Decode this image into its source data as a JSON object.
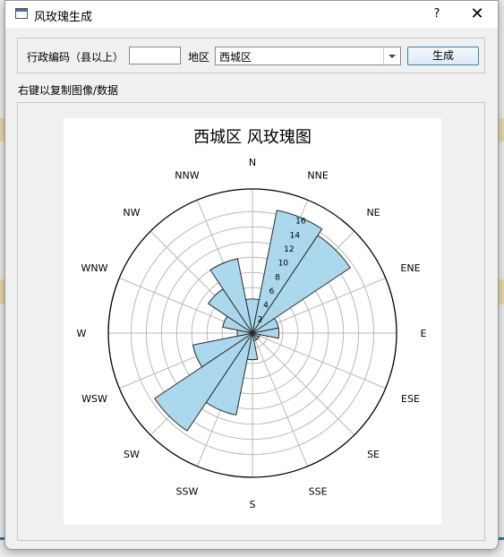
{
  "window": {
    "title": "风玫瑰生成",
    "help_label": "?",
    "close_label": "✕"
  },
  "form": {
    "code_label": "行政编码（县以上）",
    "code_value": "",
    "region_label": "地区",
    "region_value": "西城区",
    "generate_label": "生成"
  },
  "hint": "右键以复制图像/数据",
  "icons": {
    "app": "window-app-icon",
    "dropdown": "chevron-down-icon"
  },
  "colors": {
    "petal_fill": "#a7d6ec",
    "petal_stroke": "#2b2b2b",
    "grid": "#b9b9b9"
  },
  "chart_data": {
    "type": "polar-bar",
    "title": "西城区 风玫瑰图",
    "directions": [
      "N",
      "NNE",
      "NE",
      "ENE",
      "E",
      "ESE",
      "SE",
      "SSE",
      "S",
      "SSW",
      "SW",
      "WSW",
      "W",
      "WNW",
      "NW",
      "NNW"
    ],
    "values": [
      4.5,
      16.5,
      15.5,
      3.5,
      3.5,
      1.0,
      1.0,
      1.0,
      3.5,
      11.0,
      15.5,
      8.0,
      2.0,
      4.0,
      7.0,
      10.0
    ],
    "rticks": [
      2,
      4,
      6,
      8,
      10,
      12,
      14,
      16
    ],
    "rmax": 19,
    "grid": true
  }
}
